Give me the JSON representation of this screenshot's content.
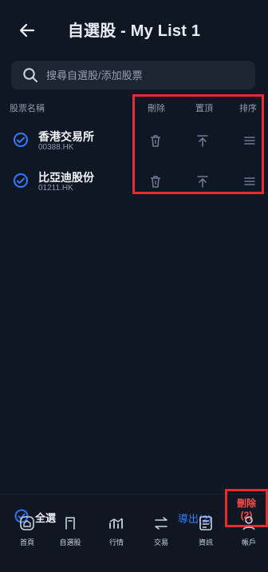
{
  "header": {
    "title": "自選股 - My List 1"
  },
  "search": {
    "placeholder": "搜尋自選股/添加股票"
  },
  "columns": {
    "name": "股票名稱",
    "delete": "刪除",
    "pin_top": "置頂",
    "sort": "排序"
  },
  "rows": [
    {
      "name": "香港交易所",
      "code": "00388.HK"
    },
    {
      "name": "比亞迪股份",
      "code": "01211.HK"
    }
  ],
  "bottom": {
    "select_all": "全選",
    "export": "導出(2)",
    "delete": "刪除(2)"
  },
  "tabs": [
    {
      "label": "首頁",
      "icon": "home-icon"
    },
    {
      "label": "自選股",
      "icon": "watchlist-icon"
    },
    {
      "label": "行情",
      "icon": "market-icon"
    },
    {
      "label": "交易",
      "icon": "trade-icon"
    },
    {
      "label": "資訊",
      "icon": "news-icon"
    },
    {
      "label": "帳戶",
      "icon": "account-icon"
    }
  ],
  "colors": {
    "accent": "#2f7cff",
    "danger": "#e82b32",
    "bg": "#0f1624"
  }
}
